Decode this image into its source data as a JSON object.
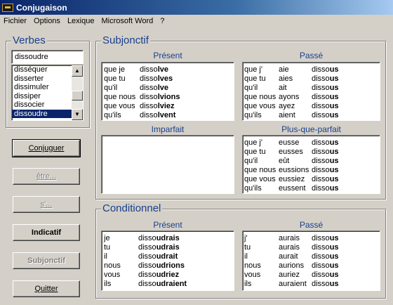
{
  "window": {
    "title": "Conjugaison"
  },
  "menu": [
    "Fichier",
    "Options",
    "Lexique",
    "Microsoft Word",
    "?"
  ],
  "verbes": {
    "title": "Verbes",
    "input_value": "dissoudre",
    "list": [
      "disséquer",
      "disserter",
      "dissimuler",
      "dissiper",
      "dissocier",
      "dissoudre"
    ],
    "selected": "dissoudre"
  },
  "buttons": {
    "conjuguer": "Conjuguer",
    "etre": "être...",
    "se": "s'...",
    "indicatif": "Indicatif",
    "subjonctif": "Subjonctif",
    "quitter": "Quitter"
  },
  "subjonctif": {
    "title": "Subjonctif",
    "present": {
      "title": "Présent",
      "rows": [
        {
          "pron": "que je",
          "stem": "disso",
          "end": "lve"
        },
        {
          "pron": "que tu",
          "stem": "disso",
          "end": "lves"
        },
        {
          "pron": "qu'il",
          "stem": "disso",
          "end": "lve"
        },
        {
          "pron": "que nous",
          "stem": "disso",
          "end": "lvions"
        },
        {
          "pron": "que vous",
          "stem": "disso",
          "end": "lviez"
        },
        {
          "pron": "qu'ils",
          "stem": "disso",
          "end": "lvent"
        }
      ]
    },
    "passe": {
      "title": "Passé",
      "rows": [
        {
          "pron": "que j'",
          "aux": "aie",
          "stem": "disso",
          "end": "us"
        },
        {
          "pron": "que tu",
          "aux": "aies",
          "stem": "disso",
          "end": "us"
        },
        {
          "pron": "qu'il",
          "aux": "ait",
          "stem": "disso",
          "end": "us"
        },
        {
          "pron": "que nous",
          "aux": "ayons",
          "stem": "disso",
          "end": "us"
        },
        {
          "pron": "que vous",
          "aux": "ayez",
          "stem": "disso",
          "end": "us"
        },
        {
          "pron": "qu'ils",
          "aux": "aient",
          "stem": "disso",
          "end": "us"
        }
      ]
    },
    "imparfait": {
      "title": "Imparfait",
      "rows": []
    },
    "plus_que_parfait": {
      "title": "Plus-que-parfait",
      "rows": [
        {
          "pron": "que j'",
          "aux": "eusse",
          "stem": "disso",
          "end": "us"
        },
        {
          "pron": "que tu",
          "aux": "eusses",
          "stem": "disso",
          "end": "us"
        },
        {
          "pron": "qu'il",
          "aux": "eût",
          "stem": "disso",
          "end": "us"
        },
        {
          "pron": "que nous",
          "aux": "eussions",
          "stem": "disso",
          "end": "us"
        },
        {
          "pron": "que vous",
          "aux": "eussiez",
          "stem": "disso",
          "end": "us"
        },
        {
          "pron": "qu'ils",
          "aux": "eussent",
          "stem": "disso",
          "end": "us"
        }
      ]
    }
  },
  "conditionnel": {
    "title": "Conditionnel",
    "present": {
      "title": "Présent",
      "rows": [
        {
          "pron": "je",
          "stem": "disso",
          "end": "udrais"
        },
        {
          "pron": "tu",
          "stem": "disso",
          "end": "udrais"
        },
        {
          "pron": "il",
          "stem": "disso",
          "end": "udrait"
        },
        {
          "pron": "nous",
          "stem": "disso",
          "end": "udrions"
        },
        {
          "pron": "vous",
          "stem": "disso",
          "end": "udriez"
        },
        {
          "pron": "ils",
          "stem": "disso",
          "end": "udraient"
        }
      ]
    },
    "passe": {
      "title": "Passé",
      "rows": [
        {
          "pron": "j'",
          "aux": "aurais",
          "stem": "disso",
          "end": "us"
        },
        {
          "pron": "tu",
          "aux": "aurais",
          "stem": "disso",
          "end": "us"
        },
        {
          "pron": "il",
          "aux": "aurait",
          "stem": "disso",
          "end": "us"
        },
        {
          "pron": "nous",
          "aux": "aurions",
          "stem": "disso",
          "end": "us"
        },
        {
          "pron": "vous",
          "aux": "auriez",
          "stem": "disso",
          "end": "us"
        },
        {
          "pron": "ils",
          "aux": "auraient",
          "stem": "disso",
          "end": "us"
        }
      ]
    }
  }
}
